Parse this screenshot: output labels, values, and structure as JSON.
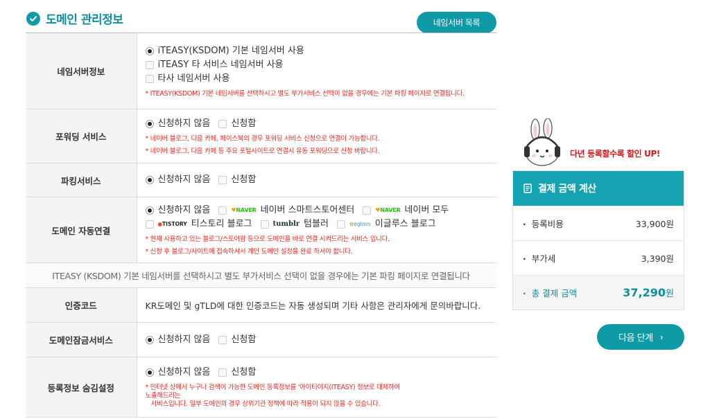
{
  "section": {
    "title": "도메인 관리정보"
  },
  "ns_list_button": "네임서버 목록",
  "rows": {
    "nameserver": {
      "label": "네임서버정보",
      "options": [
        "iTEASY(KSDOM) 기본 네임서버 사용",
        "iTEASY 타 서비스 네임서버 사용",
        "타사 네임서버 사용"
      ],
      "note": "* ITEASY(KSDOM) 기본 네임서버를 선택하시고 별도 부가서비스 선택이 없을 경우에는 기본 파킹 페이지로 연결됩니다."
    },
    "forwarding": {
      "label": "포워딩 서비스",
      "options": [
        "신청하지 않음",
        "신청함"
      ],
      "notes": [
        "* 네이버 블로그, 다음 카페, 페이스북의 경우 포워딩 서비스 신청으로 연결이 가능합니다.",
        "* 네이버 블로그, 다음 카페 등 주요 포털사이트로 연결시 유동 포워딩으로 신청 바랍니다."
      ]
    },
    "parking": {
      "label": "파킹서비스",
      "options": [
        "신청하지 않음",
        "신청함"
      ]
    },
    "autolink": {
      "label": "도메인 자동연결",
      "options": [
        "신청하지 않음",
        "네이버 스마트스토어센터",
        "네이버 모두",
        "티스토리 블로그",
        "텀블러",
        "이글루스 블로그"
      ],
      "logos": {
        "naver": "NAVER",
        "tistory": "TISTORY",
        "tumblr": "tumblr",
        "egloos": "egloos"
      },
      "notes": [
        "* 현재 사용하고 있는 블로그/스토어팜 등으로 도메인을 바로 연결 시켜드리는 서비스 입니다.",
        "* 신청 후 블로그/사이트에 접속하셔서 개인 도메인 설정을 완료 하셔야 합니다."
      ]
    },
    "fullnote": "ITEASY (KSDOM) 기본 네임서버를 선택하시고 별도 부가서비스 선택이 없을 경우에는 기본 파킹 페이지로 연결됩니다",
    "authcode": {
      "label": "인증코드",
      "text": "KR도메인 및 gTLD에 대한 인증코드는 자동 생성되며 기타 사항은 관리자에게 문의바랍니다."
    },
    "lock": {
      "label": "도메인잠금서비스",
      "options": [
        "신청하지 않음",
        "신청함"
      ]
    },
    "privacy": {
      "label": "등록정보 숨김설정",
      "options": [
        "신청하지 않음",
        "신청함"
      ],
      "note_lines": [
        "* 인터넷 상에서 누구나 검색이 가능한 도메인 등록정보를 '아이티이지(ITEASY) 정보로 대체하여",
        "노출해드리는",
        "서비스입니다. 일부 도메인의 경우 상위기관 정책에 따라 적용이 되지 않을 수 있습니다."
      ]
    }
  },
  "promo": {
    "text": "다년 등록할수록 할인 UP!"
  },
  "calc": {
    "title": "결제 금액 계산",
    "rows": [
      {
        "label": "등록비용",
        "value": "33,900원"
      },
      {
        "label": "부가세",
        "value": "3,390원"
      }
    ],
    "total": {
      "label": "총 결제 금액",
      "amount": "37,290",
      "unit": "원"
    }
  },
  "next_button": "다음 단계",
  "colors": {
    "accent": "#0e9aa7",
    "header": "#16a3b1",
    "note": "#e8261f",
    "promo": "#d31919"
  }
}
